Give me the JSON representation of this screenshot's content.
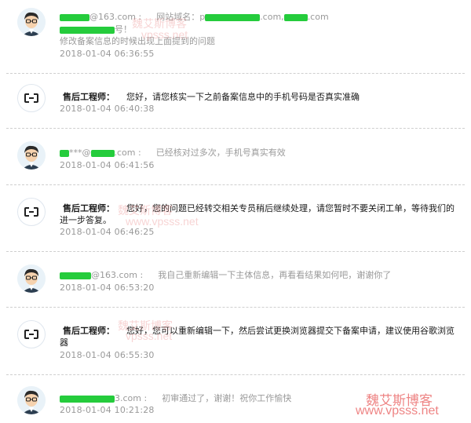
{
  "messages": [
    {
      "type": "user",
      "sender_suffix": "@163.com :",
      "site_label": "网站域名：",
      "site_domains": ".com,",
      "site_tail": ".com",
      "line2_mid": "号！",
      "text": "修改备案信息的时候出现上面提到的问题",
      "time": "2018-01-04 06:36:55"
    },
    {
      "type": "support",
      "sender": "售后工程师：",
      "text": "您好，请您核实一下之前备案信息中的手机号码是否真实准确",
      "time": "2018-01-04 06:40:38"
    },
    {
      "type": "user",
      "sender_suffix": "***@",
      "sender_tail": ".com :",
      "text": "已经核对过多次，手机号真实有效",
      "time": "2018-01-04 06:41:56"
    },
    {
      "type": "support",
      "sender": "售后工程师：",
      "text_line1": "您好，您的问题已经转交相关专员稍后继续处理，请您暂时不要关闭工单，等待我们的",
      "text_line2": "进一步答复。",
      "time": "2018-01-04 06:46:25"
    },
    {
      "type": "user",
      "sender_suffix": "@163.com :",
      "text": "我自己重新编辑一下主体信息，再看看结果如何吧，谢谢你了",
      "time": "2018-01-04 06:53:20"
    },
    {
      "type": "support",
      "sender": "售后工程师：",
      "text_line1": "您好，您可以重新编辑一下，然后尝试更换浏览器提交下备案申请，建议使用谷歌浏览",
      "text_line2": "器",
      "time": "2018-01-04 06:55:30"
    },
    {
      "type": "user",
      "sender_suffix": "3.com :",
      "text": "初审通过了，谢谢！祝你工作愉快",
      "time": "2018-01-04 10:21:28"
    }
  ],
  "watermarks": {
    "blog_name": "魏艾斯博客",
    "blog_url": "www.vpsss.net",
    "blog_url_short": "vpsss.net"
  },
  "colors": {
    "redaction": "#25cc3c",
    "divider": "#cfcfcf",
    "watermark": "#eb6e6e"
  }
}
